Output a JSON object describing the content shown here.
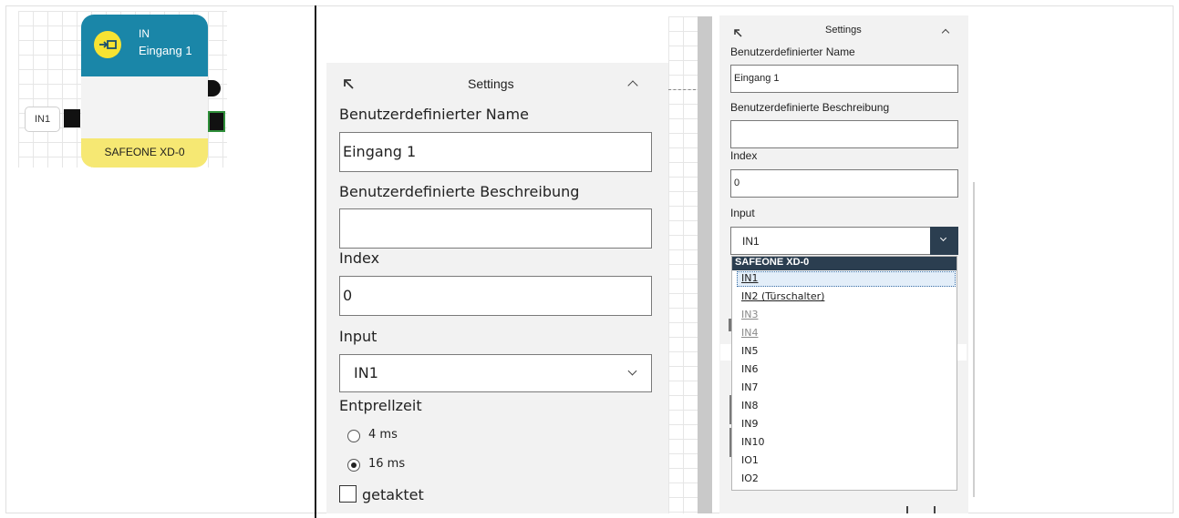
{
  "node": {
    "type_label": "IN",
    "name": "Eingang 1",
    "device": "SAFEONE XD-0",
    "input_tag": "IN1",
    "colors": {
      "header": "#1a86a8",
      "icon": "#f6e332",
      "footer": "#f6e873"
    },
    "icon": "input-arrow-icon"
  },
  "settings_large": {
    "title": "Settings",
    "name_label": "Benutzerdefinierter Name",
    "name_value": "Eingang 1",
    "desc_label": "Benutzerdefinierte Beschreibung",
    "desc_value": "",
    "index_label": "Index",
    "index_value": "0",
    "input_label": "Input",
    "input_value": "IN1",
    "debounce_label": "Entprellzeit",
    "debounce_options": [
      "4 ms",
      "16 ms"
    ],
    "debounce_selected": "16 ms",
    "clocked_label": "getaktet",
    "clocked_checked": false
  },
  "settings_small": {
    "title": "Settings",
    "name_label": "Benutzerdefinierter Name",
    "name_value": "Eingang 1",
    "desc_label": "Benutzerdefinierte Beschreibung",
    "desc_value": "",
    "index_label": "Index",
    "index_value": "0",
    "input_label": "Input",
    "input_value": "IN1"
  },
  "dropdown": {
    "group_header": "SAFEONE XD-0",
    "items": [
      {
        "label": "IN1",
        "state": "selected"
      },
      {
        "label": "IN2 (Türschalter)",
        "state": "underlined"
      },
      {
        "label": "IN3",
        "state": "disabled"
      },
      {
        "label": "IN4",
        "state": "disabled"
      },
      {
        "label": "IN5",
        "state": "normal"
      },
      {
        "label": "IN6",
        "state": "normal"
      },
      {
        "label": "IN7",
        "state": "normal"
      },
      {
        "label": "IN8",
        "state": "normal"
      },
      {
        "label": "IN9",
        "state": "normal"
      },
      {
        "label": "IN10",
        "state": "normal"
      },
      {
        "label": "IO1",
        "state": "normal"
      },
      {
        "label": "IO2",
        "state": "normal"
      }
    ]
  }
}
